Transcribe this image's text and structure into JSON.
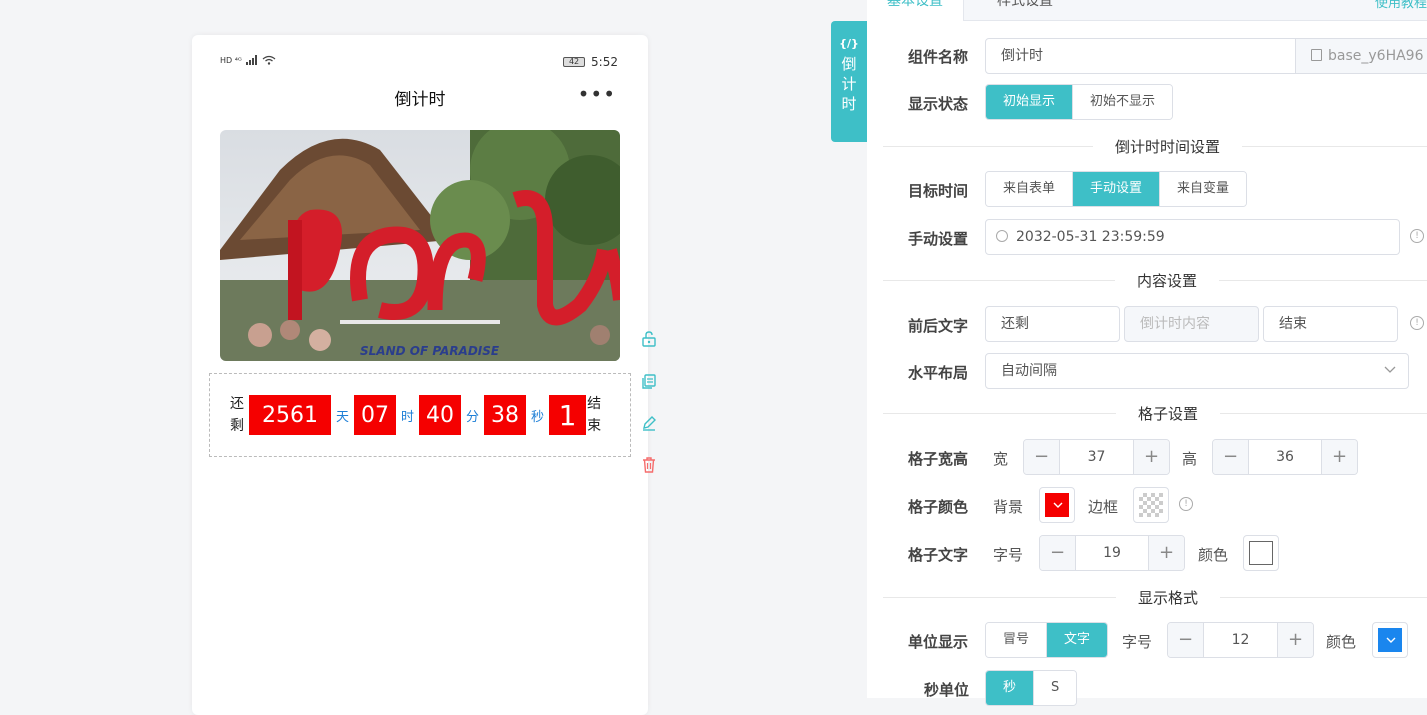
{
  "phone": {
    "status_left": "HD ⁴ᴳ",
    "battery": "42",
    "time": "5:52",
    "title": "倒计时",
    "more": "•••"
  },
  "countdown": {
    "prefix": [
      "还",
      "剩"
    ],
    "suffix": [
      "结",
      "束"
    ],
    "segments": [
      {
        "value": "2561",
        "unit": "天"
      },
      {
        "value": "07",
        "unit": "时"
      },
      {
        "value": "40",
        "unit": "分"
      },
      {
        "value": "38",
        "unit": "秒"
      },
      {
        "value": "1",
        "unit": ""
      }
    ],
    "cell_color": "#f50000",
    "unit_color": "#1e7fd6"
  },
  "vtab": {
    "tag": "{/}",
    "chars": [
      "倒",
      "计",
      "时"
    ]
  },
  "panel": {
    "tabs": [
      "基本设置",
      "样式设置"
    ],
    "help": "使用教程",
    "component_name_label": "组件名称",
    "component_name_value": "倒计时",
    "component_id": "base_y6HA96",
    "display_state_label": "显示状态",
    "display_state_options": [
      "初始显示",
      "初始不显示"
    ],
    "section_time": "倒计时时间设置",
    "target_time_label": "目标时间",
    "target_time_options": [
      "来自表单",
      "手动设置",
      "来自变量"
    ],
    "manual_label": "手动设置",
    "manual_value": "2032-05-31 23:59:59",
    "section_content": "内容设置",
    "before_after_label": "前后文字",
    "before_text": "还剩",
    "content_placeholder": "倒计时内容",
    "after_text": "结束",
    "layout_label": "水平布局",
    "layout_value": "自动间隔",
    "section_cell": "格子设置",
    "cell_size_label": "格子宽高",
    "width_label": "宽",
    "width_value": "37",
    "height_label": "高",
    "height_value": "36",
    "cell_color_label": "格子颜色",
    "bg_label": "背景",
    "border_label": "边框",
    "cell_text_label": "格子文字",
    "font_size_label": "字号",
    "font_size_value": "19",
    "color_label": "颜色",
    "section_format": "显示格式",
    "unit_display_label": "单位显示",
    "unit_display_options": [
      "冒号",
      "文字"
    ],
    "unit_font_label": "字号",
    "unit_font_value": "12",
    "unit_color_label": "颜色",
    "second_unit_label": "秒单位",
    "second_unit_options": [
      "秒",
      "S"
    ],
    "accent": "#3ebfc7",
    "bg_color": "#f50000",
    "unit_color": "#1e7fd6"
  }
}
